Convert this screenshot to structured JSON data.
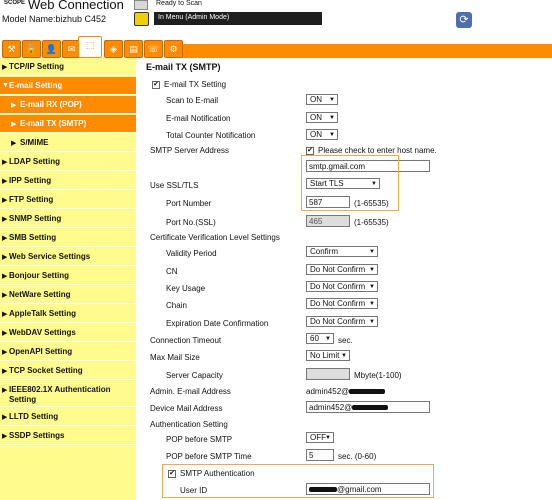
{
  "header": {
    "brand_small": "SCOPE",
    "brand": "Web Connection",
    "model": "Model Name:bizhub C452",
    "status": "Ready to Scan",
    "mode": "In Menu (Admin Mode)",
    "refresh_icon": "refresh-icon"
  },
  "tabs": [
    {
      "icon": "maintenance-icon",
      "glyph": "⚒"
    },
    {
      "icon": "security-icon",
      "glyph": "🔒"
    },
    {
      "icon": "user-auth-icon",
      "glyph": "👤"
    },
    {
      "icon": "store-address-icon",
      "glyph": "✉"
    },
    {
      "icon": "network-icon",
      "glyph": "⬚"
    },
    {
      "icon": "box-icon",
      "glyph": "◈"
    },
    {
      "icon": "print-setting-icon",
      "glyph": "▤"
    },
    {
      "icon": "fax-icon",
      "glyph": "☏"
    },
    {
      "icon": "system-icon",
      "glyph": "⚙"
    }
  ],
  "sidebar": {
    "items": [
      {
        "label": "TCP/IP Setting"
      },
      {
        "label": "E-mail Setting"
      },
      {
        "label": "E-mail RX (POP)"
      },
      {
        "label": "E-mail TX (SMTP)"
      },
      {
        "label": "S/MIME"
      },
      {
        "label": "LDAP Setting"
      },
      {
        "label": "IPP Setting"
      },
      {
        "label": "FTP Setting"
      },
      {
        "label": "SNMP Setting"
      },
      {
        "label": "SMB Setting"
      },
      {
        "label": "Web Service Settings"
      },
      {
        "label": "Bonjour Setting"
      },
      {
        "label": "NetWare Setting"
      },
      {
        "label": "AppleTalk Setting"
      },
      {
        "label": "WebDAV Settings"
      },
      {
        "label": "OpenAPI Setting"
      },
      {
        "label": "TCP Socket Setting"
      },
      {
        "label": "IEEE802.1X Authentication Setting"
      },
      {
        "label": "LLTD Setting"
      },
      {
        "label": "SSDP Settings"
      }
    ]
  },
  "main": {
    "title": "E-mail TX (SMTP)",
    "email_tx": {
      "label": "E-mail TX Setting",
      "checked": true
    },
    "scan_to_email": {
      "label": "Scan to E-mail",
      "value": "ON"
    },
    "email_notification": {
      "label": "E-mail Notification",
      "value": "ON"
    },
    "total_counter": {
      "label": "Total Counter Notification",
      "value": "ON"
    },
    "smtp_server": {
      "label": "SMTP Server Address",
      "check_label": "Please check to enter host name.",
      "value": "smtp.gmail.com"
    },
    "ssl": {
      "label": "Use SSL/TLS",
      "value": "Start TLS"
    },
    "port": {
      "label": "Port Number",
      "value": "587",
      "range": "(1-65535)"
    },
    "port_ssl": {
      "label": "Port No.(SSL)",
      "value": "465",
      "range": "(1-65535)"
    },
    "cert": {
      "label": "Certificate Verification Level Settings"
    },
    "validity": {
      "label": "Validity Period",
      "value": "Confirm"
    },
    "cn": {
      "label": "CN",
      "value": "Do Not Confirm"
    },
    "key_usage": {
      "label": "Key Usage",
      "value": "Do Not Confirm"
    },
    "chain": {
      "label": "Chain",
      "value": "Do Not Confirm"
    },
    "expiration": {
      "label": "Expiration Date Confirmation",
      "value": "Do Not Confirm"
    },
    "timeout": {
      "label": "Connection Timeout",
      "value": "60",
      "unit": "sec."
    },
    "max_mail": {
      "label": "Max Mail Size",
      "value": "No Limit"
    },
    "server_capacity": {
      "label": "Server Capacity",
      "unit": "Mbyte(1-100)"
    },
    "admin_email": {
      "label": "Admin. E-mail Address",
      "value": "admin452@"
    },
    "device_mail": {
      "label": "Device Mail Address",
      "value": "admin452@"
    },
    "auth": {
      "label": "Authentication Setting"
    },
    "pop_before": {
      "label": "POP before SMTP",
      "value": "OFF"
    },
    "pop_time": {
      "label": "POP before SMTP Time",
      "value": "5",
      "unit": "sec. (0-60)"
    },
    "smtp_auth": {
      "label": "SMTP Authentication",
      "checked": true
    },
    "user_id": {
      "label": "User ID",
      "suffix": "@gmail.com"
    }
  },
  "colors": {
    "accent": "#ff8c00",
    "sidebar": "#fffb8c",
    "highlight": "#f4a64a"
  }
}
